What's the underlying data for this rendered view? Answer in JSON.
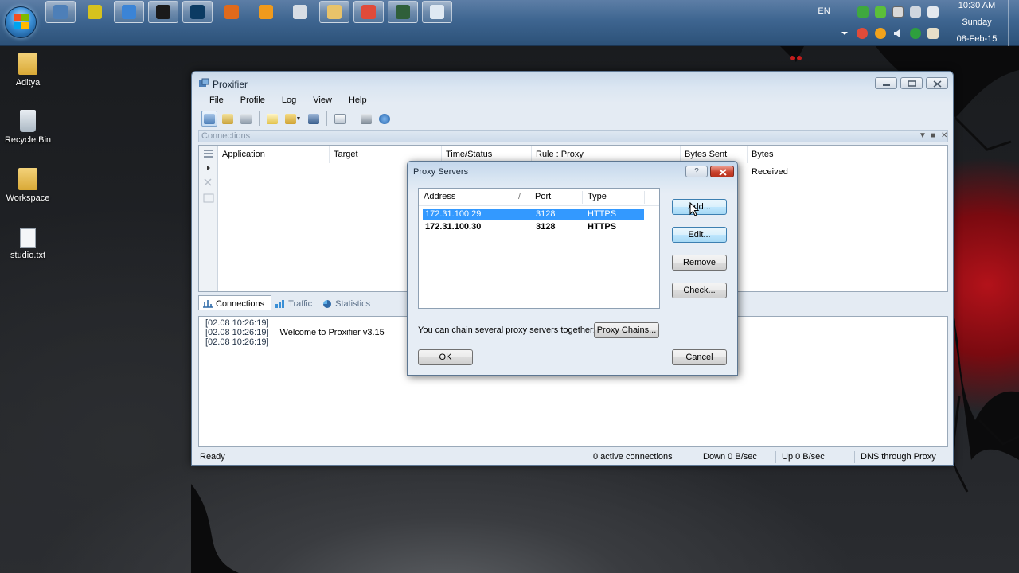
{
  "taskbar": {
    "language": "EN",
    "clock": {
      "time": "10:30 AM",
      "day": "Sunday",
      "date": "08-Feb-15"
    },
    "apps": [
      {
        "icon": "proxifier-icon",
        "active": true,
        "color": "#4d7fb8"
      },
      {
        "icon": "media-disc-icon",
        "active": false,
        "color": "#d6c21e"
      },
      {
        "icon": "settings-app-icon",
        "active": true,
        "color": "#3b84d6"
      },
      {
        "icon": "dark-circle-app-icon",
        "active": true,
        "color": "#1a1a1a"
      },
      {
        "icon": "photoshop-icon",
        "active": true,
        "color": "#0b3b63"
      },
      {
        "icon": "firefox-icon",
        "active": false,
        "color": "#e06a1b"
      },
      {
        "icon": "media-player-icon",
        "active": false,
        "color": "#f09a1c"
      },
      {
        "icon": "film-editor-icon",
        "active": false,
        "color": "#d7dde4"
      },
      {
        "icon": "folder-icon",
        "active": true,
        "color": "#e8c36a"
      },
      {
        "icon": "chrome-icon",
        "active": true,
        "color": "#e04b3a"
      },
      {
        "icon": "terminal-icon",
        "active": true,
        "color": "#2f5f3a"
      },
      {
        "icon": "notepad-icon",
        "active": true,
        "color": "#dfe9f2"
      }
    ]
  },
  "desktop": {
    "icons": [
      {
        "label": "Aditya",
        "type": "user-folder-icon"
      },
      {
        "label": "Recycle Bin",
        "type": "recycle-bin-icon"
      },
      {
        "label": "Workspace",
        "type": "folder-icon"
      },
      {
        "label": "studio.txt",
        "type": "text-file-icon"
      }
    ]
  },
  "window": {
    "title": "Proxifier",
    "menu": [
      "File",
      "Profile",
      "Log",
      "View",
      "Help"
    ],
    "connections_panel": {
      "title": "Connections",
      "columns": [
        "Application",
        "Target",
        "Time/Status",
        "Rule : Proxy",
        "Bytes Sent",
        "Bytes Received"
      ]
    },
    "tabs": [
      "Connections",
      "Traffic",
      "Statistics"
    ],
    "log": [
      {
        "time": "[02.08 10:26:19]",
        "message": ""
      },
      {
        "time": "[02.08 10:26:19]",
        "message": "Welcome to Proxifier v3.15"
      },
      {
        "time": "[02.08 10:26:19]",
        "message": ""
      }
    ],
    "status": {
      "state": "Ready",
      "active": "0 active connections",
      "down": "Down 0 B/sec",
      "up": "Up 0 B/sec",
      "dns": "DNS through Proxy"
    }
  },
  "dialog": {
    "title": "Proxy Servers",
    "help": "?",
    "columns": {
      "address": "Address",
      "sort": "/",
      "port": "Port",
      "type": "Type"
    },
    "rows": [
      {
        "address": "172.31.100.29",
        "port": "3128",
        "type": "HTTPS",
        "selected": true
      },
      {
        "address": "172.31.100.30",
        "port": "3128",
        "type": "HTTPS",
        "selected": false
      }
    ],
    "buttons": {
      "add": "Add...",
      "edit": "Edit...",
      "remove": "Remove",
      "check": "Check...",
      "ok": "OK",
      "cancel": "Cancel"
    },
    "chain_text": "You can chain several proxy servers together:",
    "chain_button": "Proxy Chains..."
  },
  "colors": {
    "selection": "#3399ff",
    "taskbar": "#3e6590",
    "close_red": "#c9442f"
  }
}
